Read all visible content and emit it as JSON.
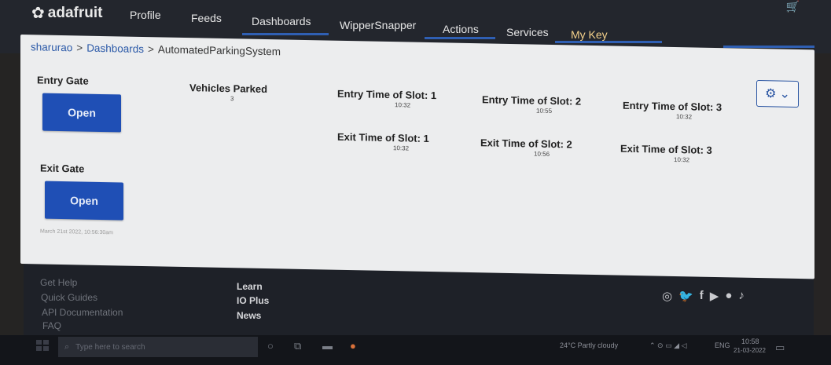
{
  "nav": {
    "logo": "adafruit",
    "items": [
      "Profile",
      "Feeds",
      "Dashboards",
      "WipperSnapper",
      "Actions",
      "Services"
    ],
    "my_key": "My Key"
  },
  "breadcrumb": {
    "user": "sharurao",
    "sep": ">",
    "section": "Dashboards",
    "page": "AutomatedParkingSystem"
  },
  "dashboard": {
    "entry_gate": {
      "title": "Entry Gate",
      "button": "Open"
    },
    "exit_gate": {
      "title": "Exit Gate",
      "button": "Open"
    },
    "vehicles_parked": {
      "title": "Vehicles Parked",
      "value": "3"
    },
    "entry_times": [
      {
        "title": "Entry Time of Slot: 1",
        "value": "10:32"
      },
      {
        "title": "Entry Time of Slot: 2",
        "value": "10:55"
      },
      {
        "title": "Entry Time of Slot: 3",
        "value": "10:32"
      }
    ],
    "exit_times": [
      {
        "title": "Exit Time of Slot: 1",
        "value": "10:32"
      },
      {
        "title": "Exit Time of Slot: 2",
        "value": "10:56"
      },
      {
        "title": "Exit Time of Slot: 3",
        "value": "10:32"
      }
    ],
    "timestamp": "March 21st 2022, 10:56:30am"
  },
  "footer": {
    "col1": [
      "Get Help",
      "Quick Guides",
      "API Documentation",
      "FAQ"
    ],
    "col2": [
      "Learn",
      "IO Plus",
      "News"
    ],
    "social_icons": [
      "instagram-icon",
      "twitter-icon",
      "facebook-icon",
      "youtube-icon",
      "github-icon",
      "tiktok-icon"
    ]
  },
  "taskbar": {
    "search_placeholder": "Type here to search",
    "weather": "24°C  Partly cloudy",
    "lang": "ENG",
    "time": "10:58",
    "date": "21-03-2022"
  },
  "colors": {
    "nav_bg": "#23262d",
    "accent": "#1f4fb5",
    "panel_bg": "#ecedee",
    "my_key": "#f3d08a"
  }
}
